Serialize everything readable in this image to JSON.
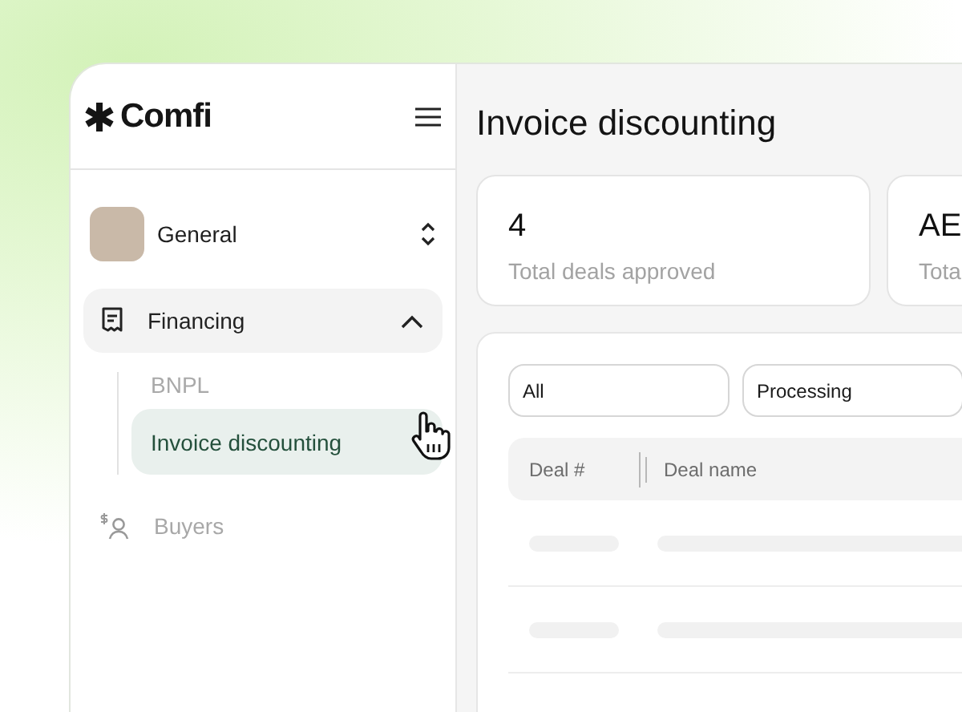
{
  "logo": {
    "text": "Comfi"
  },
  "account": {
    "name": "General"
  },
  "nav": [
    {
      "label": "Financing",
      "kind": "group",
      "expanded": true,
      "children": [
        {
          "label": "BNPL",
          "selected": false
        },
        {
          "label": "Invoice discounting",
          "selected": true
        }
      ]
    },
    {
      "label": "Buyers",
      "kind": "link"
    }
  ],
  "page": {
    "title": "Invoice discounting"
  },
  "stats": [
    {
      "value": "4",
      "label": "Total deals approved"
    },
    {
      "value": "AE",
      "label": "Tota"
    }
  ],
  "filters": [
    {
      "value": "All"
    },
    {
      "value": "Processing"
    }
  ],
  "table": {
    "columns": [
      "Deal #",
      "Deal name"
    ]
  }
}
